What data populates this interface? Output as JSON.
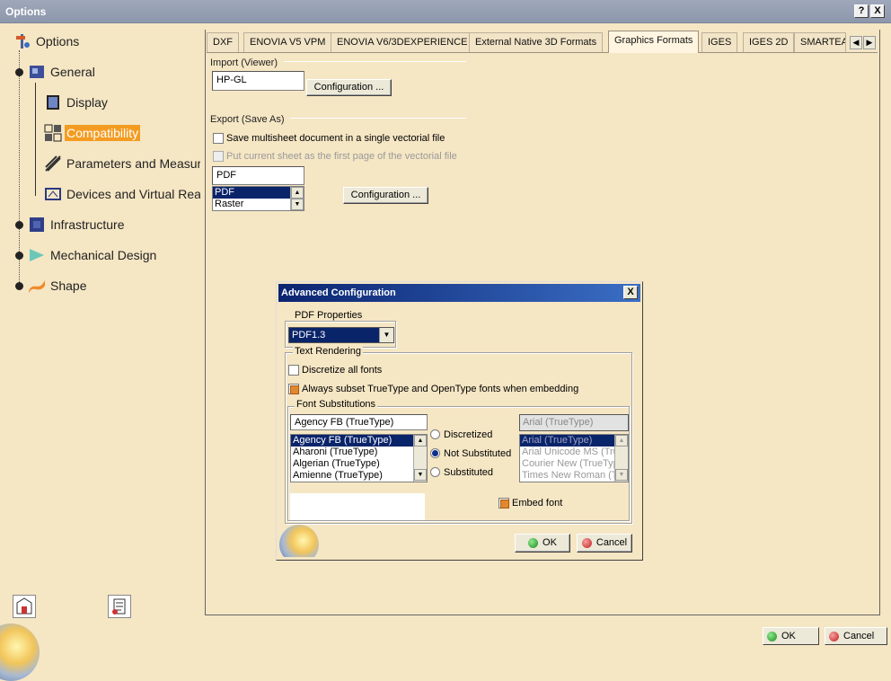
{
  "window": {
    "title": "Options",
    "help_label": "?",
    "close_label": "X"
  },
  "tree": {
    "items": [
      {
        "label": "Options"
      },
      {
        "label": "General"
      },
      {
        "label": "Display"
      },
      {
        "label": "Compatibility"
      },
      {
        "label": "Parameters and Measure"
      },
      {
        "label": "Devices and Virtual Reali"
      },
      {
        "label": "Infrastructure"
      },
      {
        "label": "Mechanical Design"
      },
      {
        "label": "Shape"
      }
    ]
  },
  "tabs": [
    {
      "label": "DXF"
    },
    {
      "label": "ENOVIA V5 VPM"
    },
    {
      "label": "ENOVIA V6/3DEXPERIENCE"
    },
    {
      "label": "External Native 3D Formats"
    },
    {
      "label": "Graphics Formats"
    },
    {
      "label": "IGES"
    },
    {
      "label": "IGES 2D"
    },
    {
      "label": "SMARTEA"
    }
  ],
  "tab_scroll": {
    "left": "◀",
    "right": "▶"
  },
  "import": {
    "group_label": "Import (Viewer)",
    "value": "HP-GL",
    "config_label": "Configuration ..."
  },
  "export": {
    "group_label": "Export (Save As)",
    "save_multisheet_label": "Save multisheet document in a single vectorial file",
    "put_current_label": "Put current sheet as the first page of the vectorial file",
    "format_value": "PDF",
    "format_options": [
      "PDF",
      "Raster"
    ],
    "config_label": "Configuration ..."
  },
  "dialog": {
    "title": "Advanced Configuration",
    "close_label": "X",
    "pdf_properties_label": "PDF Properties",
    "pdf_version": "PDF1.3",
    "text_rendering_label": "Text Rendering",
    "discretize_label": "Discretize all fonts",
    "always_subset_label": "Always subset TrueType and OpenType fonts when embedding",
    "font_subst_label": "Font Substitutions",
    "source_font_value": "Agency FB (TrueType)",
    "source_fonts": [
      "Agency FB (TrueType)",
      "Aharoni (TrueType)",
      "Algerian (TrueType)",
      "Amienne (TrueType)"
    ],
    "radio_discretized": "Discretized",
    "radio_not_substituted": "Not Substituted",
    "radio_substituted": "Substituted",
    "target_font_value": "Arial (TrueType)",
    "target_fonts": [
      "Arial (TrueType)",
      "Arial Unicode MS (Tru",
      "Courier New (TrueTyp",
      "Times New Roman (Tr"
    ],
    "embed_font_label": "Embed font",
    "ok_label": "OK",
    "cancel_label": "Cancel"
  },
  "bottom": {
    "ok_label": "OK",
    "cancel_label": "Cancel"
  },
  "colors": {
    "accent": "#f39c21",
    "selection": "#0a246a",
    "title_active": "#0b2470",
    "panel": "#f5e6c4"
  }
}
